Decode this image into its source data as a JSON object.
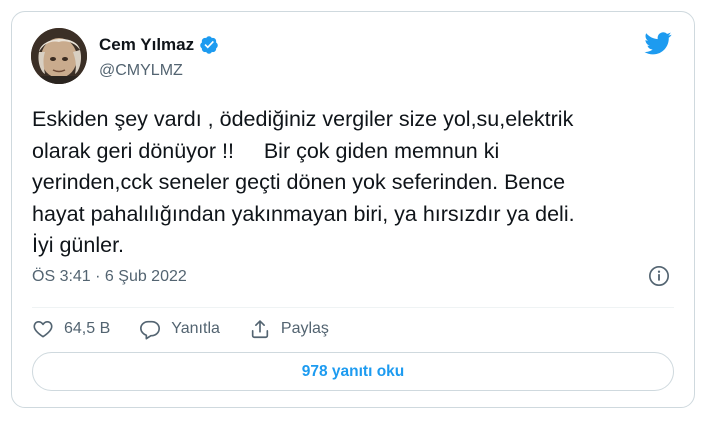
{
  "author": {
    "name": "Cem Yılmaz",
    "handle": "@CMYLMZ",
    "verified_icon": "verified-badge-icon"
  },
  "brand": {
    "logo_icon": "twitter-bird-icon",
    "accent": "#1d9bf0"
  },
  "tweet": {
    "text": "Eskiden şey vardı , ödediğiniz vergiler size yol,su,elektrik\nolarak geri dönüyor !!     Bir çok giden memnun ki\nyerinden,cck seneler geçti dönen yok seferinden. Bence\nhayat pahalılığından yakınmayan biri, ya hırsızdır ya deli.\nİyi günler.",
    "timestamp": "ÖS 3:41 · 6 Şub 2022"
  },
  "actions": {
    "like": {
      "icon": "heart-icon",
      "label": "64,5 B"
    },
    "reply": {
      "icon": "speech-bubble-icon",
      "label": "Yanıtla"
    },
    "share": {
      "icon": "share-icon",
      "label": "Paylaş"
    }
  },
  "replies_button": {
    "label": "978 yanıtı oku"
  },
  "colors": {
    "text_primary": "#0f1419",
    "text_secondary": "#536471",
    "border": "#cfd9de"
  }
}
